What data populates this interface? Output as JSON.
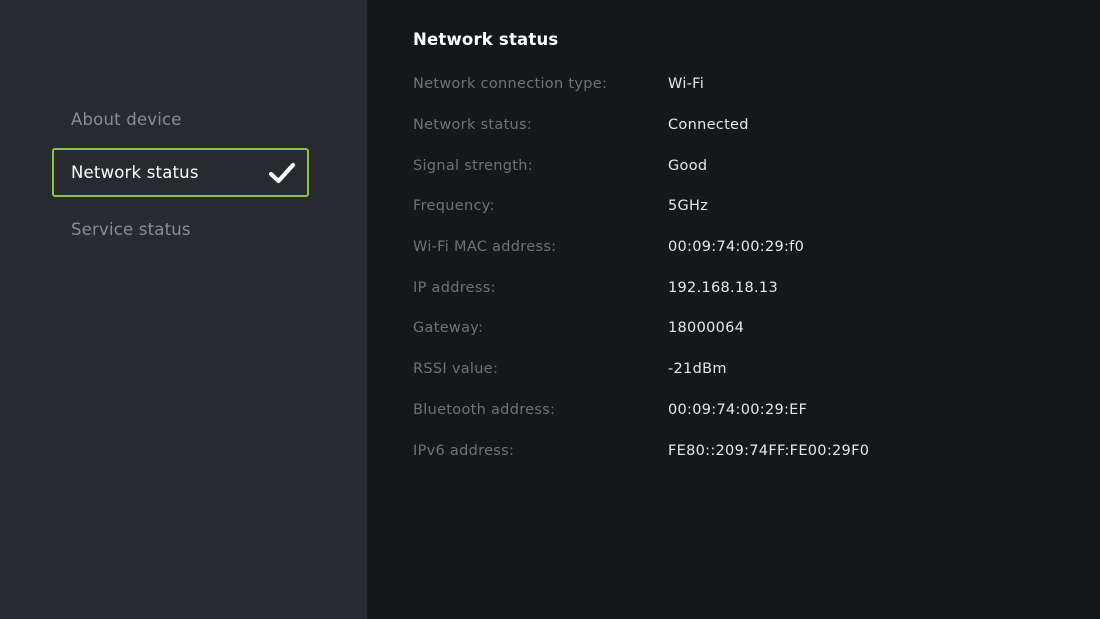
{
  "sidebar": {
    "items": [
      {
        "label": "About device",
        "selected": false
      },
      {
        "label": "Network status",
        "selected": true
      },
      {
        "label": "Service status",
        "selected": false
      }
    ]
  },
  "main": {
    "title": "Network status",
    "rows": [
      {
        "label": "Network connection type:",
        "value": "Wi-Fi"
      },
      {
        "label": "Network status:",
        "value": "Connected"
      },
      {
        "label": "Signal strength:",
        "value": "Good"
      },
      {
        "label": "Frequency:",
        "value": "5GHz"
      },
      {
        "label": "Wi-Fi MAC address:",
        "value": "00:09:74:00:29:f0"
      },
      {
        "label": "IP address:",
        "value": "192.168.18.13"
      },
      {
        "label": "Gateway:",
        "value": "18000064"
      },
      {
        "label": "RSSI value:",
        "value": "-21dBm"
      },
      {
        "label": "Bluetooth address:",
        "value": "00:09:74:00:29:EF"
      },
      {
        "label": "IPv6 address:",
        "value": "FE80::209:74FF:FE00:29F0"
      }
    ]
  },
  "colors": {
    "accent": "#8bc34a",
    "sidebar_bg": "#272a2e",
    "main_bg": "#15181b"
  },
  "icons": {
    "selected_indicator": "checkmark-icon"
  }
}
